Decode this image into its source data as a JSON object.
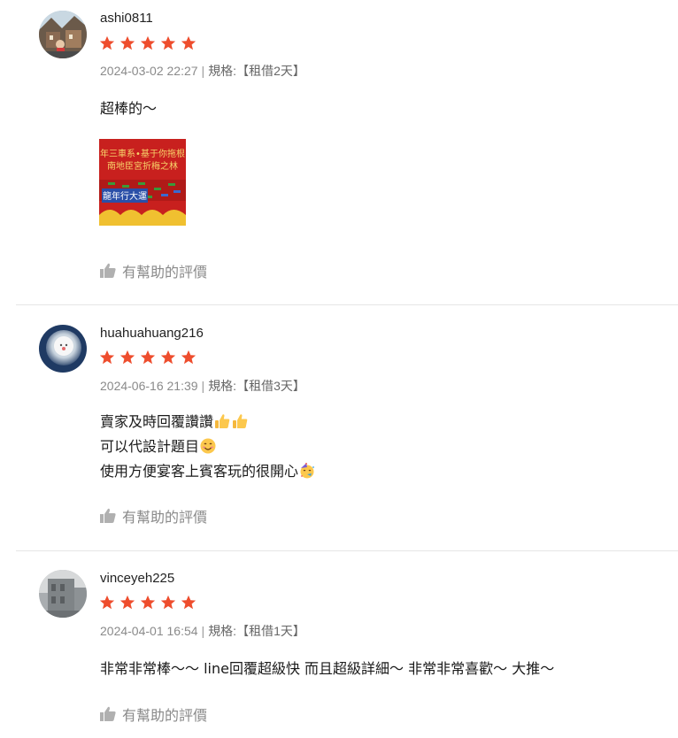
{
  "colors": {
    "star": "#ee4d2d",
    "meta": "#8a8a8a",
    "divider": "#e6e6e6"
  },
  "reviews": [
    {
      "username": "ashi0811",
      "rating": 5,
      "date": "2024-03-02 22:27",
      "spec_label": "規格:",
      "spec_value": "【租借2天】",
      "content_lines": [
        "超棒的～"
      ],
      "photo": {
        "line1": "年三車系•基于你拖根",
        "line2": "南地臣宮折梅之林",
        "badge": "龍年行大運"
      },
      "helpful_label": "有幫助的評價"
    },
    {
      "username": "huahuahuang216",
      "rating": 5,
      "date": "2024-06-16 21:39",
      "spec_label": "規格:",
      "spec_value": "【租借3天】",
      "content_lines": [
        "賣家及時回覆讚讚",
        "可以代設計題目",
        "使用方便宴客上賓客玩的很開心"
      ],
      "emojis": [
        "thumbs-up-icon",
        "thumbs-up-icon",
        "smiling-face-icon",
        "party-face-icon"
      ],
      "helpful_label": "有幫助的評價"
    },
    {
      "username": "vinceyeh225",
      "rating": 5,
      "date": "2024-04-01 16:54",
      "spec_label": "規格:",
      "spec_value": "【租借1天】",
      "content_lines": [
        "非常非常棒～～ line回覆超級快 而且超級詳細～ 非常非常喜歡～ 大推～"
      ],
      "helpful_label": "有幫助的評價"
    }
  ]
}
